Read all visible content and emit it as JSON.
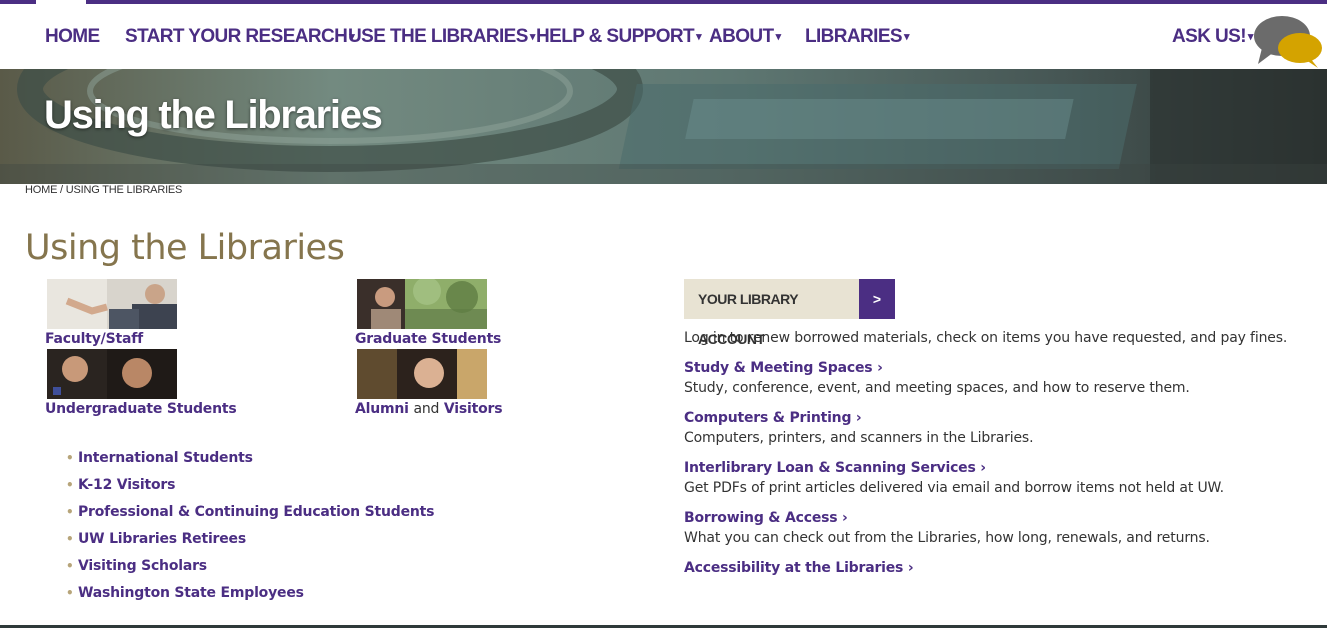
{
  "nav": {
    "items": [
      {
        "label": "HOME",
        "has_menu": false
      },
      {
        "label": "START YOUR RESEARCH",
        "has_menu": true
      },
      {
        "label": "USE THE LIBRARIES",
        "has_menu": true
      },
      {
        "label": "HELP & SUPPORT",
        "has_menu": true
      },
      {
        "label": "ABOUT",
        "has_menu": true
      },
      {
        "label": "LIBRARIES",
        "has_menu": true
      }
    ],
    "ask_us": "ASK US!",
    "caret": "▾"
  },
  "hero": {
    "title": "Using the Libraries"
  },
  "breadcrumb": {
    "home": "HOME",
    "separator": " / ",
    "current": "USING THE LIBRARIES"
  },
  "page_title": "Using the Libraries",
  "audiences": [
    {
      "label": "Faculty/Staff"
    },
    {
      "label": "Graduate Students"
    },
    {
      "label": "Undergraduate Students"
    },
    {
      "label_part1": "Alumni",
      "label_and": "and",
      "label_part2": "Visitors"
    }
  ],
  "other_audiences": [
    "International Students",
    "K-12 Visitors",
    "Professional & Continuing Education Students",
    "UW Libraries Retirees",
    "Visiting Scholars",
    "Washington State Employees"
  ],
  "bullet_char": "•",
  "account": {
    "label": "YOUR LIBRARY ACCOUNT",
    "button": ">",
    "description": "Log in to renew borrowed materials, check on items you have requested, and pay fines."
  },
  "services": [
    {
      "title": "Study & Meeting Spaces ›",
      "description": "Study, conference, event, and meeting spaces, and how to reserve them."
    },
    {
      "title": "Computers & Printing ›",
      "description": "Computers, printers, and scanners in the Libraries."
    },
    {
      "title": "Interlibrary Loan & Scanning Services ›",
      "description": "Get PDFs of print articles delivered via email and borrow items not held at UW."
    },
    {
      "title": "Borrowing & Access ›",
      "description": "What you can check out from the Libraries, how long, renewals, and returns."
    },
    {
      "title": "Accessibility at the Libraries ›",
      "description": ""
    }
  ],
  "colors": {
    "brand_purple": "#4b2e83",
    "gold": "#85754d",
    "account_bg": "#e8e3d3"
  }
}
